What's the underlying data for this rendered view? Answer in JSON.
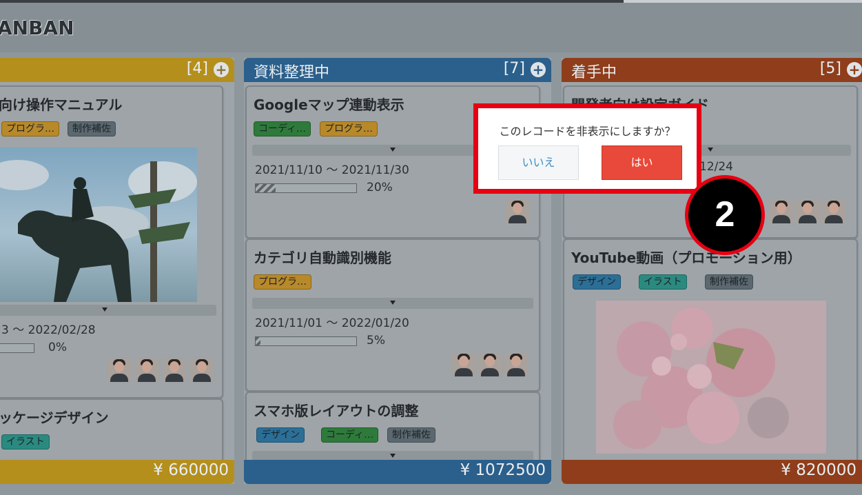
{
  "app": {
    "title": "ANBAN"
  },
  "columns": [
    {
      "title": "",
      "count": "[4]",
      "color": "#c9a21f",
      "total": "¥ 660000",
      "cards": [
        {
          "title": "向け操作マニュアル",
          "tags": [
            "プログラ…",
            "制作補佐"
          ],
          "dates": "3 ～ 2022/02/28",
          "progress_text": "0%",
          "progress": 0
        },
        {
          "title": "ッケージデザイン",
          "tags": [
            "イラスト"
          ]
        }
      ]
    },
    {
      "title": "資料整理中",
      "count": "[7]",
      "color": "#2f6fa5",
      "total": "¥ 1072500",
      "cards": [
        {
          "title": "Googleマップ連動表示",
          "tags": [
            "コーディ…",
            "プログラ…"
          ],
          "dates": "2021/11/10 ～ 2021/11/30",
          "progress_text": "20%",
          "progress": 0.2
        },
        {
          "title": "カテゴリ自動識別機能",
          "tags": [
            "プログラ…"
          ],
          "dates": "2021/11/01 ～ 2022/01/20",
          "progress_text": "5%",
          "progress": 0.05
        },
        {
          "title": "スマホ版レイアウトの調整",
          "tags": [
            "デザイン",
            "コーディ…",
            "制作補佐"
          ]
        }
      ]
    },
    {
      "title": "着手中",
      "count": "[5]",
      "color": "#a4461f",
      "total": "¥ 820000",
      "cards": [
        {
          "title": "開発者向け設定ガイド",
          "dates_partial": "12/24"
        },
        {
          "title": "YouTube動画（プロモーション用）",
          "tags": [
            "デザイン",
            "イラスト",
            "制作補佐"
          ]
        }
      ]
    }
  ],
  "dialog": {
    "message": "このレコードを非表示にしますか？",
    "no_label": "いいえ",
    "yes_label": "はい"
  },
  "step_marker": "2",
  "icons": {
    "add": "plus-circle-icon",
    "expand": "caret-down-icon"
  }
}
